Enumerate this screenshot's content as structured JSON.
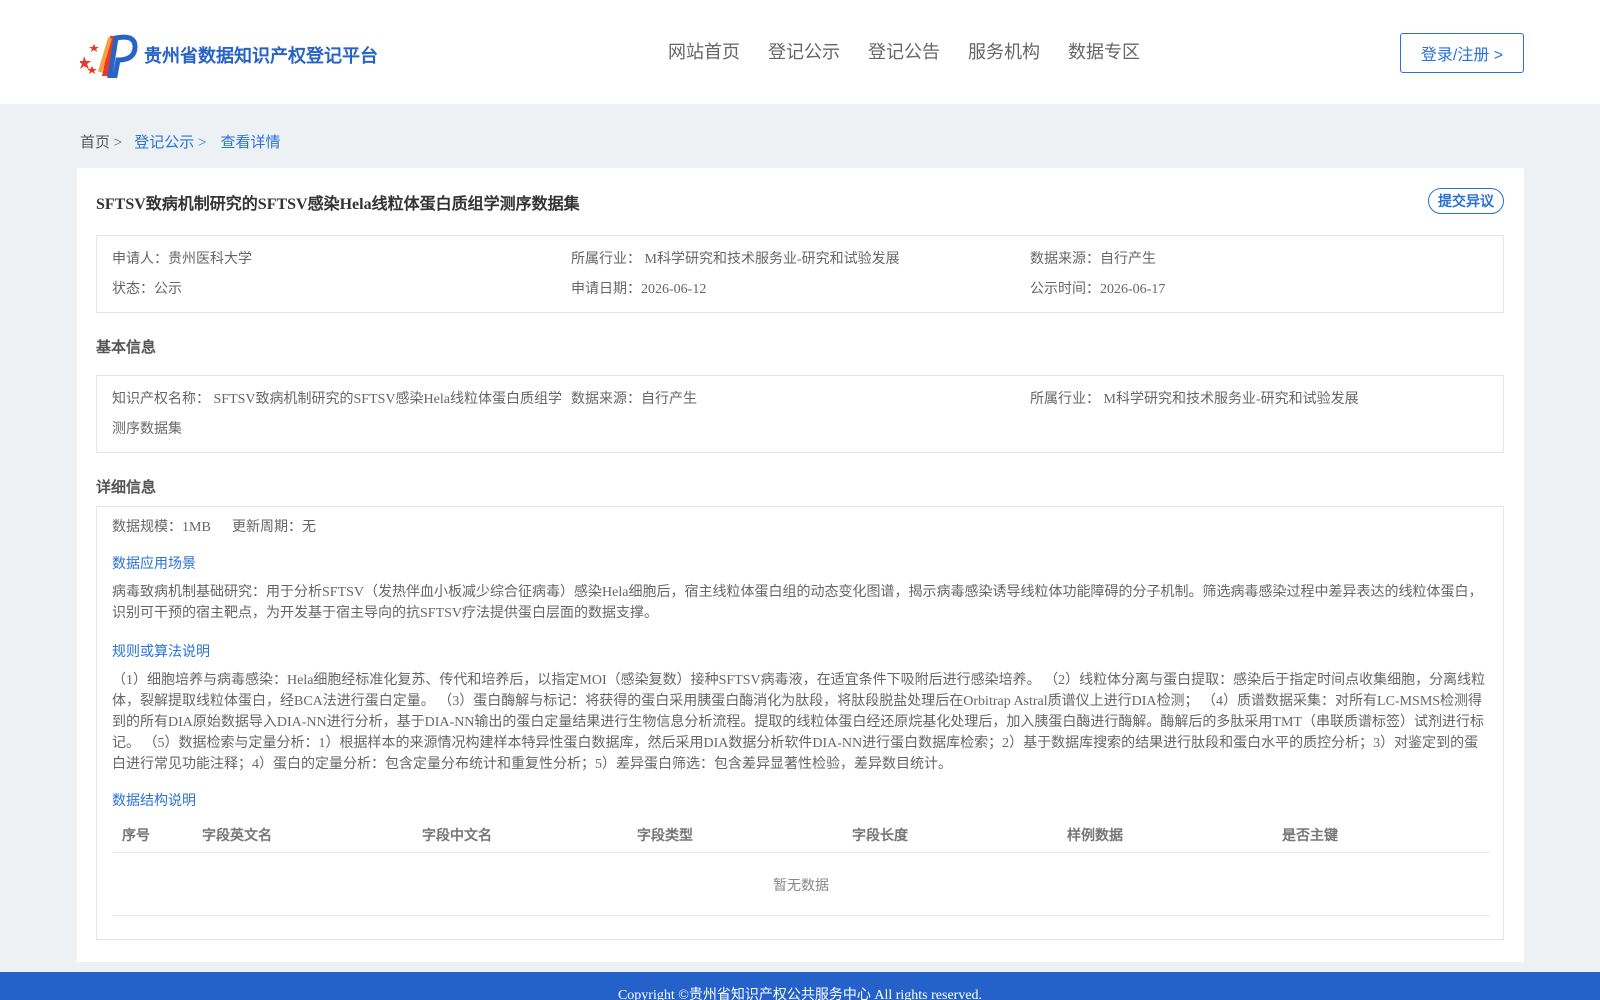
{
  "header": {
    "site_name": "贵州省数据知识产权登记平台",
    "nav": [
      "网站首页",
      "登记公示",
      "登记公告",
      "服务机构",
      "数据专区"
    ],
    "login": "登录/注册 >"
  },
  "breadcrumb": {
    "home": "首页 >",
    "registry": "登记公示 >",
    "current": "查看详情"
  },
  "detail": {
    "title": "SFTSV致病机制研究的SFTSV感染Hela线粒体蛋白质组学测序数据集",
    "objection_button": "提交异议",
    "summary": {
      "applicant": "申请人：贵州医科大学",
      "industry": "所属行业： M科学研究和技术服务业-研究和试验发展",
      "source": "数据来源：自行产生",
      "status": "状态：公示",
      "apply_date": "申请日期：2026-06-12",
      "publish_date": "公示时间：2026-06-17"
    },
    "basic_info": {
      "heading": "基本信息",
      "ip_name_line1": "知识产权名称： SFTSV致病机制研究的SFTSV感染Hela线粒体蛋白质组学",
      "ip_name_line2": "测序数据集",
      "source": "数据来源：自行产生",
      "industry": "所属行业： M科学研究和技术服务业-研究和试验发展"
    },
    "detail_info": {
      "heading": "详细信息",
      "scale": "数据规模：1MB",
      "update_cycle": "更新周期：无",
      "scenario_title": "数据应用场景",
      "scenario_text": "病毒致病机制基础研究：用于分析SFTSV（发热伴血小板减少综合征病毒）感染Hela细胞后，宿主线粒体蛋白组的动态变化图谱，揭示病毒感染诱导线粒体功能障碍的分子机制。筛选病毒感染过程中差异表达的线粒体蛋白，识别可干预的宿主靶点，为开发基于宿主导向的抗SFTSV疗法提供蛋白层面的数据支撑。",
      "algorithm_title": "规则或算法说明",
      "algorithm_text": "（1）细胞培养与病毒感染：Hela细胞经标准化复苏、传代和培养后，以指定MOI（感染复数）接种SFTSV病毒液，在适宜条件下吸附后进行感染培养。 （2）线粒体分离与蛋白提取：感染后于指定时间点收集细胞，分离线粒体，裂解提取线粒体蛋白，经BCA法进行蛋白定量。 （3）蛋白酶解与标记：将获得的蛋白采用胰蛋白酶消化为肽段，将肽段脱盐处理后在Orbitrap Astral质谱仪上进行DIA检测； （4）质谱数据采集：对所有LC-MSMS检测得到的所有DIA原始数据导入DIA-NN进行分析，基于DIA-NN输出的蛋白定量结果进行生物信息分析流程。提取的线粒体蛋白经还原烷基化处理后，加入胰蛋白酶进行酶解。酶解后的多肽采用TMT（串联质谱标签）试剂进行标记。 （5）数据检索与定量分析：1）根据样本的来源情况构建样本特异性蛋白数据库，然后采用DIA数据分析软件DIA-NN进行蛋白数据库检索；2）基于数据库搜索的结果进行肽段和蛋白水平的质控分析；3）对鉴定到的蛋白进行常见功能注释；4）蛋白的定量分析：包含定量分布统计和重复性分析；5）差异蛋白筛选：包含差异显著性检验，差异数目统计。",
      "structure_title": "数据结构说明",
      "table_headers": [
        "序号",
        "字段英文名",
        "字段中文名",
        "字段类型",
        "字段长度",
        "样例数据",
        "是否主键"
      ],
      "empty_text": "暂无数据"
    }
  },
  "footer": {
    "copyright": "Copyright ©贵州省知识产权公共服务中心 All rights reserved."
  },
  "colors": {
    "brand_blue": "#2a63c6",
    "link_blue": "#2a72d6",
    "footer_blue": "#2461c8",
    "page_bg": "#eef1f4"
  }
}
